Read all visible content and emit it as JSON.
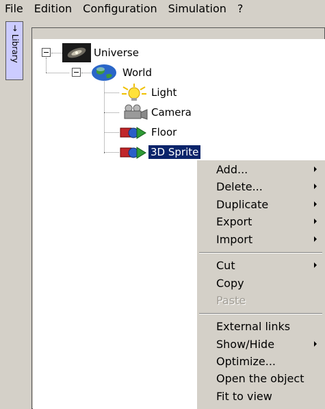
{
  "menubar": {
    "items": [
      {
        "label": "File"
      },
      {
        "label": "Edition"
      },
      {
        "label": "Configuration"
      },
      {
        "label": "Simulation"
      },
      {
        "label": "?"
      }
    ]
  },
  "sidebar": {
    "tab_label": "→ Library"
  },
  "tree": {
    "nodes": [
      {
        "label": "Universe",
        "icon": "galaxy-icon"
      },
      {
        "label": "World",
        "icon": "globe-icon"
      },
      {
        "label": "Light",
        "icon": "lightbulb-icon"
      },
      {
        "label": "Camera",
        "icon": "camera-icon"
      },
      {
        "label": "Floor",
        "icon": "object-icon"
      },
      {
        "label": "3D Sprite",
        "icon": "object-icon",
        "selected": true
      }
    ],
    "selection_color": "#0a246a"
  },
  "context_menu": {
    "items": [
      {
        "label": "Add...",
        "submenu": true
      },
      {
        "label": "Delete...",
        "submenu": true
      },
      {
        "label": "Duplicate",
        "submenu": true
      },
      {
        "label": "Export",
        "submenu": true
      },
      {
        "label": "Import",
        "submenu": true
      },
      {
        "label": "Cut",
        "submenu": true
      },
      {
        "label": "Copy",
        "submenu": false
      },
      {
        "label": "Paste",
        "submenu": false,
        "disabled": true
      },
      {
        "label": "External links",
        "submenu": false
      },
      {
        "label": "Show/Hide",
        "submenu": true
      },
      {
        "label": "Optimize...",
        "submenu": false
      },
      {
        "label": "Open the object",
        "submenu": false
      },
      {
        "label": "Fit to view",
        "submenu": false
      }
    ]
  }
}
